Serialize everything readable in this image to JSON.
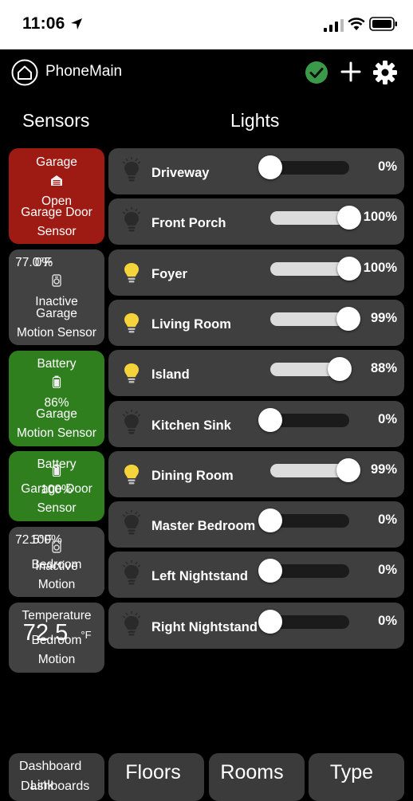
{
  "status_bar": {
    "time": "11:06"
  },
  "header": {
    "title": "PhoneMain"
  },
  "columns": {
    "sensors": "Sensors",
    "lights": "Lights"
  },
  "sensors": [
    {
      "lines": [
        "Garage",
        "Open",
        "Garage Door",
        "Sensor"
      ],
      "color": "#9e1b14",
      "icon": "garage-door-icon"
    },
    {
      "lines": [
        "77.0°F",
        "0%",
        "Inactive",
        "Garage",
        "Motion Sensor"
      ],
      "color": "#424242",
      "icon": "motion-sensor-icon"
    },
    {
      "lines": [
        "Battery",
        "86%",
        "Garage",
        "Motion Sensor"
      ],
      "color": "#2f7f1f",
      "icon": "battery-icon"
    },
    {
      "lines": [
        "Battery",
        "100%",
        "Garage Door",
        "Sensor"
      ],
      "color": "#2f7f1f",
      "icon": "battery-icon"
    },
    {
      "lines": [
        "72.5°F",
        "100%",
        "Bedroom",
        "Inactive",
        "Motion"
      ],
      "color": "#424242",
      "icon": "motion-sensor-icon"
    },
    {
      "lines": [
        "Temperature",
        "72.5",
        "°F",
        "Bedroom",
        "Motion"
      ],
      "color": "#424242",
      "icon": ""
    }
  ],
  "lights": [
    {
      "name": "Driveway",
      "level": 0,
      "percent": "0%",
      "on": false
    },
    {
      "name": "Front Porch",
      "level": 100,
      "percent": "100%",
      "on": false
    },
    {
      "name": "Foyer",
      "level": 100,
      "percent": "100%",
      "on": true
    },
    {
      "name": "Living Room",
      "level": 99,
      "percent": "99%",
      "on": true
    },
    {
      "name": "Island",
      "level": 88,
      "percent": "88%",
      "on": true
    },
    {
      "name": "Kitchen Sink",
      "level": 0,
      "percent": "0%",
      "on": false
    },
    {
      "name": "Dining Room",
      "level": 99,
      "percent": "99%",
      "on": true
    },
    {
      "name": "Master Bedroom",
      "level": 0,
      "percent": "0%",
      "on": false
    },
    {
      "name": "Left Nightstand",
      "level": 0,
      "percent": "0%",
      "on": false
    },
    {
      "name": "Right Nightstand",
      "level": 0,
      "percent": "0%",
      "on": false
    }
  ],
  "nav": {
    "dashboard_line1": "Dashboard",
    "dashboard_line2": "Link",
    "dashboard_line3": "Dashboards",
    "floors": "Floors",
    "rooms": "Rooms",
    "type": "Type"
  },
  "colors": {
    "bulb_on": "#f5d33a",
    "bulb_off": "#2a2a2a",
    "check": "#3a9a4a"
  }
}
